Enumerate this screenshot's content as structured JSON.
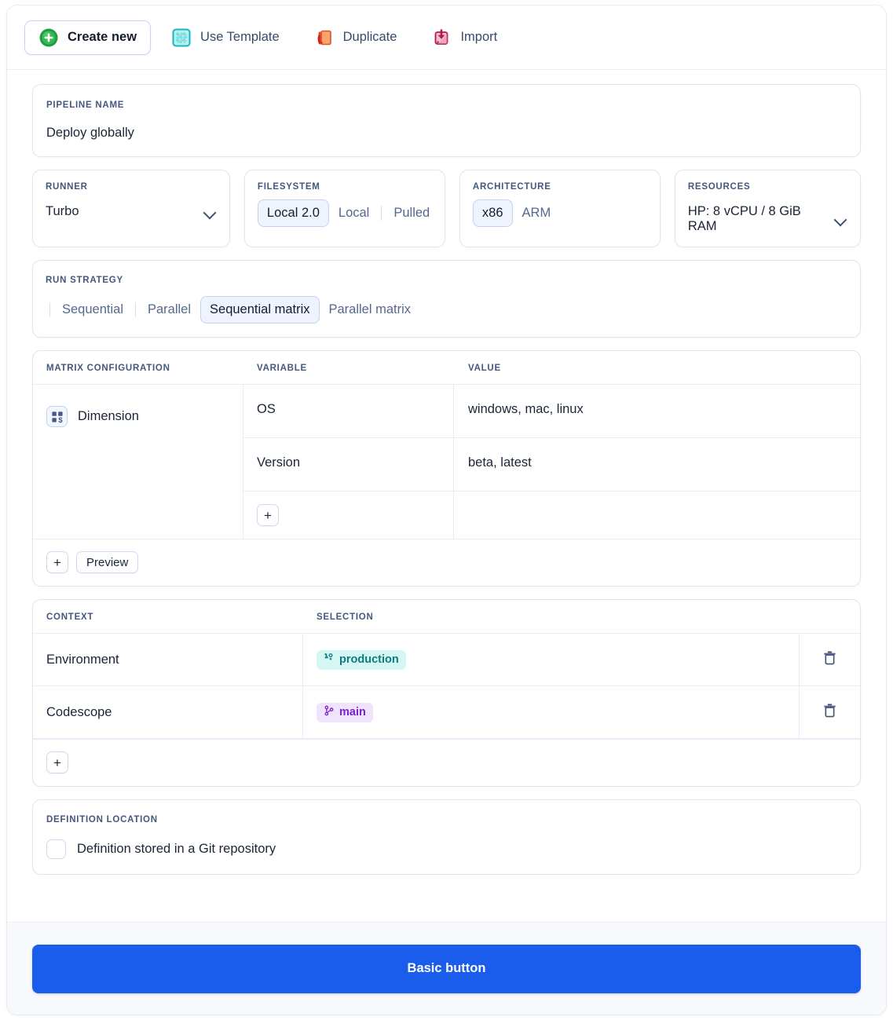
{
  "toolbar": {
    "buttons": [
      {
        "label": "Create new",
        "icon": "plus-circle-icon",
        "active": true
      },
      {
        "label": "Use Template",
        "icon": "template-grid-icon",
        "active": false
      },
      {
        "label": "Duplicate",
        "icon": "duplicate-pages-icon",
        "active": false
      },
      {
        "label": "Import",
        "icon": "import-arrow-icon",
        "active": false
      }
    ]
  },
  "pipeline_name": {
    "label": "PIPELINE NAME",
    "value": "Deploy globally"
  },
  "runner": {
    "label": "RUNNER",
    "value": "Turbo",
    "icon": "chevron-down-icon"
  },
  "filesystem": {
    "label": "FILESYSTEM",
    "options": [
      "Local 2.0",
      "Local",
      "Pulled"
    ],
    "selected": "Local 2.0"
  },
  "architecture": {
    "label": "ARCHITECTURE",
    "options": [
      "x86",
      "ARM"
    ],
    "selected": "x86"
  },
  "resources": {
    "label": "RESOURCES",
    "value": "HP: 8 vCPU / 8 GiB RAM",
    "icon": "chevron-down-icon"
  },
  "run_strategy": {
    "label": "RUN STRATEGY",
    "options": [
      "Sequential",
      "Parallel",
      "Sequential matrix",
      "Parallel matrix"
    ],
    "selected": "Sequential matrix"
  },
  "matrix": {
    "headers": [
      "MATRIX CONFIGURATION",
      "VARIABLE",
      "VALUE"
    ],
    "dimension": {
      "label": "Dimension",
      "icon": "matrix-grid-dollar-icon"
    },
    "rows": [
      {
        "variable": "OS",
        "value": "windows, mac, linux"
      },
      {
        "variable": "Version",
        "value": "beta, latest"
      }
    ],
    "add_variable_label": "+",
    "footer": {
      "add_label": "+",
      "preview_label": "Preview"
    }
  },
  "context": {
    "headers": [
      "CONTEXT",
      "SELECTION"
    ],
    "rows": [
      {
        "name": "Environment",
        "badge": "production",
        "badge_icon": "users-add-icon",
        "badge_style": "teal",
        "delete_icon": "trash-icon"
      },
      {
        "name": "Codescope",
        "badge": "main",
        "badge_icon": "git-branch-icon",
        "badge_style": "purple",
        "delete_icon": "trash-icon"
      }
    ],
    "footer": {
      "add_label": "+"
    }
  },
  "definition_location": {
    "label": "DEFINITION LOCATION",
    "checkbox_label": "Definition stored in a Git repository",
    "checked": false
  },
  "footer": {
    "primary_label": "Basic button"
  },
  "colors": {
    "accent": "#1a5ceb",
    "label": "#44577c",
    "text": "#1b2437",
    "border": "#dde5f2",
    "teal_badge_bg": "#d4f7f4",
    "teal_badge_fg": "#0f7a7f",
    "purple_badge_bg": "#f0e4fd",
    "purple_badge_fg": "#7d22d6",
    "footer_bg": "#f7f9fd"
  }
}
